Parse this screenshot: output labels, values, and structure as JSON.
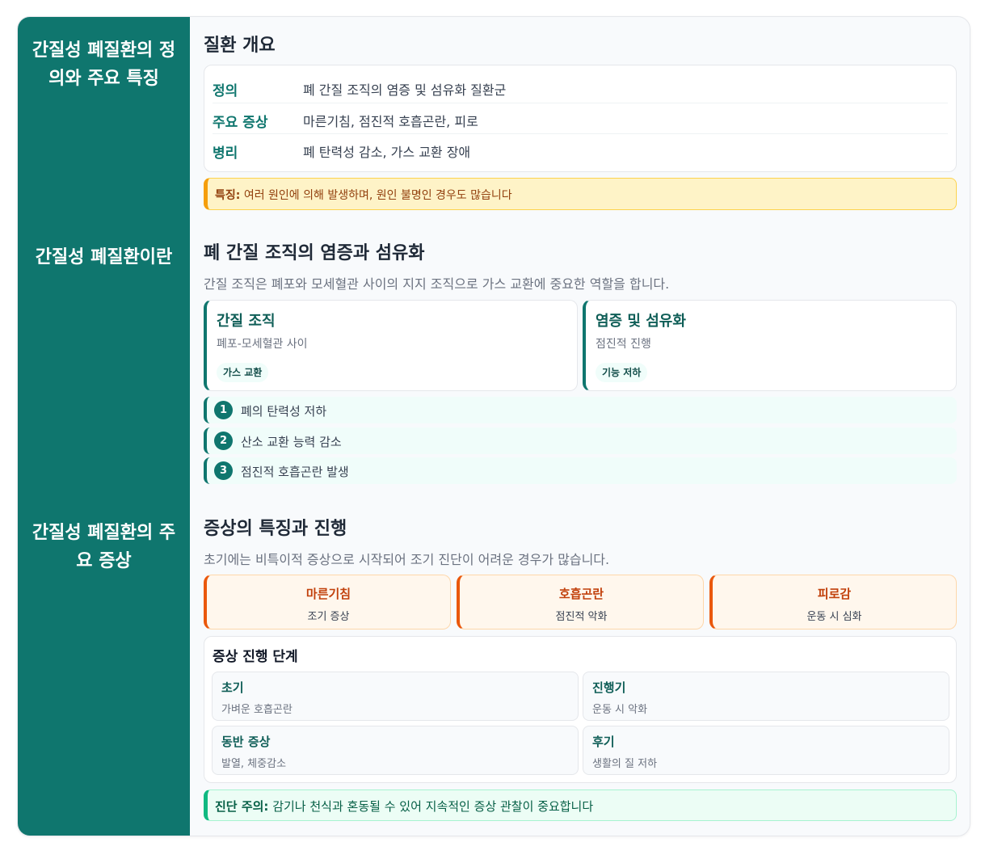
{
  "sidebar": {
    "titles": [
      "간질성 폐질환의 정의와 주요 특징",
      "간질성 폐질환이란",
      "간질성 폐질환의 주요 증상"
    ]
  },
  "overview": {
    "heading": "질환 개요",
    "rows": [
      {
        "key": "정의",
        "value": "폐 간질 조직의 염증 및 섬유화 질환군"
      },
      {
        "key": "주요 증상",
        "value": "마른기침, 점진적 호흡곤란, 피로"
      },
      {
        "key": "병리",
        "value": "폐 탄력성 감소, 가스 교환 장애"
      }
    ],
    "note_label": "특징:",
    "note_text": "여러 원인에 의해 발생하며, 원인 불명인 경우도 많습니다"
  },
  "pathology": {
    "heading": "폐 간질 조직의 염증과 섬유화",
    "lead": "간질 조직은 폐포와 모세혈관 사이의 지지 조직으로 가스 교환에 중요한 역할을 합니다.",
    "cards": [
      {
        "title": "간질 조직",
        "desc": "폐포-모세혈관 사이",
        "chip": "가스 교환"
      },
      {
        "title": "염증 및 섬유화",
        "desc": "점진적 진행",
        "chip": "기능 저하"
      }
    ],
    "steps": [
      {
        "num": "1",
        "text": "폐의 탄력성 저하"
      },
      {
        "num": "2",
        "text": "산소 교환 능력 감소"
      },
      {
        "num": "3",
        "text": "점진적 호흡곤란 발생"
      }
    ]
  },
  "symptoms": {
    "heading": "증상의 특징과 진행",
    "lead": "초기에는 비특이적 증상으로 시작되어 조기 진단이 어려운 경우가 많습니다.",
    "cards": [
      {
        "name": "마른기침",
        "sub": "조기 증상"
      },
      {
        "name": "호흡곤란",
        "sub": "점진적 악화"
      },
      {
        "name": "피로감",
        "sub": "운동 시 심화"
      }
    ],
    "progress_title": "증상 진행 단계",
    "stages": [
      {
        "name": "초기",
        "desc": "가벼운 호흡곤란"
      },
      {
        "name": "진행기",
        "desc": "운동 시 악화"
      },
      {
        "name": "동반 증상",
        "desc": "발열, 체중감소"
      },
      {
        "name": "후기",
        "desc": "생활의 질 저하"
      }
    ],
    "note_label": "진단 주의:",
    "note_text": "감기나 천식과 혼동될 수 있어 지속적인 증상 관찰이 중요합니다"
  }
}
